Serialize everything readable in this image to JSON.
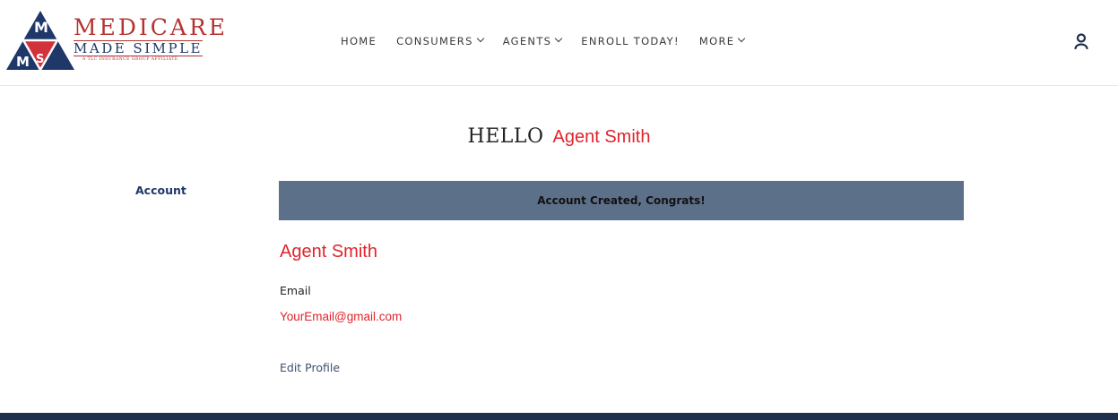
{
  "logo": {
    "letters": [
      "M",
      "M",
      "S"
    ],
    "line1": "MEDICARE",
    "line2": "MADE SIMPLE",
    "line3": "A TLC INSURANCE GROUP AFFILIATE"
  },
  "nav": {
    "items": [
      {
        "label": "HOME",
        "dropdown": false
      },
      {
        "label": "CONSUMERS",
        "dropdown": true
      },
      {
        "label": "AGENTS",
        "dropdown": true
      },
      {
        "label": "ENROLL TODAY!",
        "dropdown": false
      },
      {
        "label": "MORE",
        "dropdown": true
      }
    ],
    "user_icon": "user-icon"
  },
  "greeting": {
    "hello": "HELLO",
    "name": "Agent Smith"
  },
  "sidebar": {
    "account_label": "Account"
  },
  "banner": {
    "text": "Account Created, Congrats!"
  },
  "profile": {
    "name": "Agent Smith",
    "email_label": "Email",
    "email_value": "YourEmail@gmail.com",
    "edit_label": "Edit Profile"
  },
  "colors": {
    "accent_red": "#e0242b",
    "navy": "#1f3869",
    "banner": "#5d7089",
    "footer": "#1f2f4e"
  }
}
